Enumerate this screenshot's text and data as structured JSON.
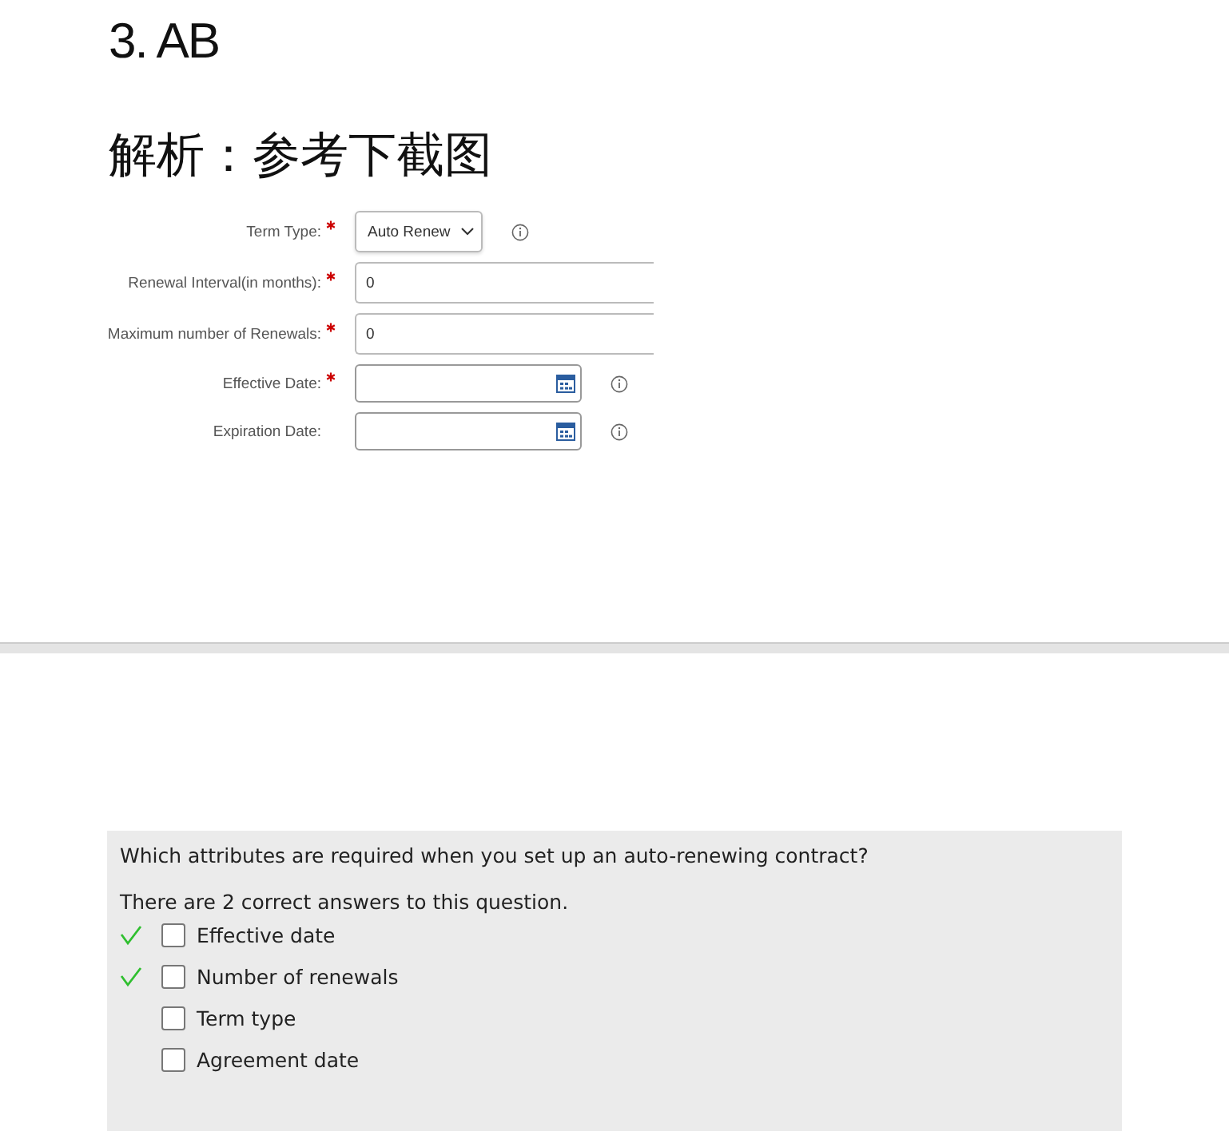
{
  "heading": "3. AB",
  "analysis": "解析：参考下截图",
  "form": [
    {
      "kind": "select",
      "label": "Term Type:",
      "required": true,
      "value": "Auto Renew",
      "info": true
    },
    {
      "kind": "text",
      "label": "Renewal Interval(in months):",
      "required": true,
      "value": "0",
      "info": false
    },
    {
      "kind": "text",
      "label": "Maximum number of Renewals:",
      "required": true,
      "value": "0",
      "info": false
    },
    {
      "kind": "date",
      "label": "Effective Date:",
      "required": true,
      "info": true
    },
    {
      "kind": "date",
      "label": "Expiration Date:",
      "required": false,
      "info": true
    }
  ],
  "question": {
    "text": "Which attributes are required when you set up an auto-renewing contract?",
    "hint": "There are 2 correct answers to this question.",
    "options": [
      {
        "label": "Effective date",
        "correct": true,
        "checked": false
      },
      {
        "label": "Number of renewals",
        "correct": true,
        "checked": false
      },
      {
        "label": "Term type",
        "correct": false,
        "checked": false
      },
      {
        "label": "Agreement date",
        "correct": false,
        "checked": false
      }
    ]
  }
}
